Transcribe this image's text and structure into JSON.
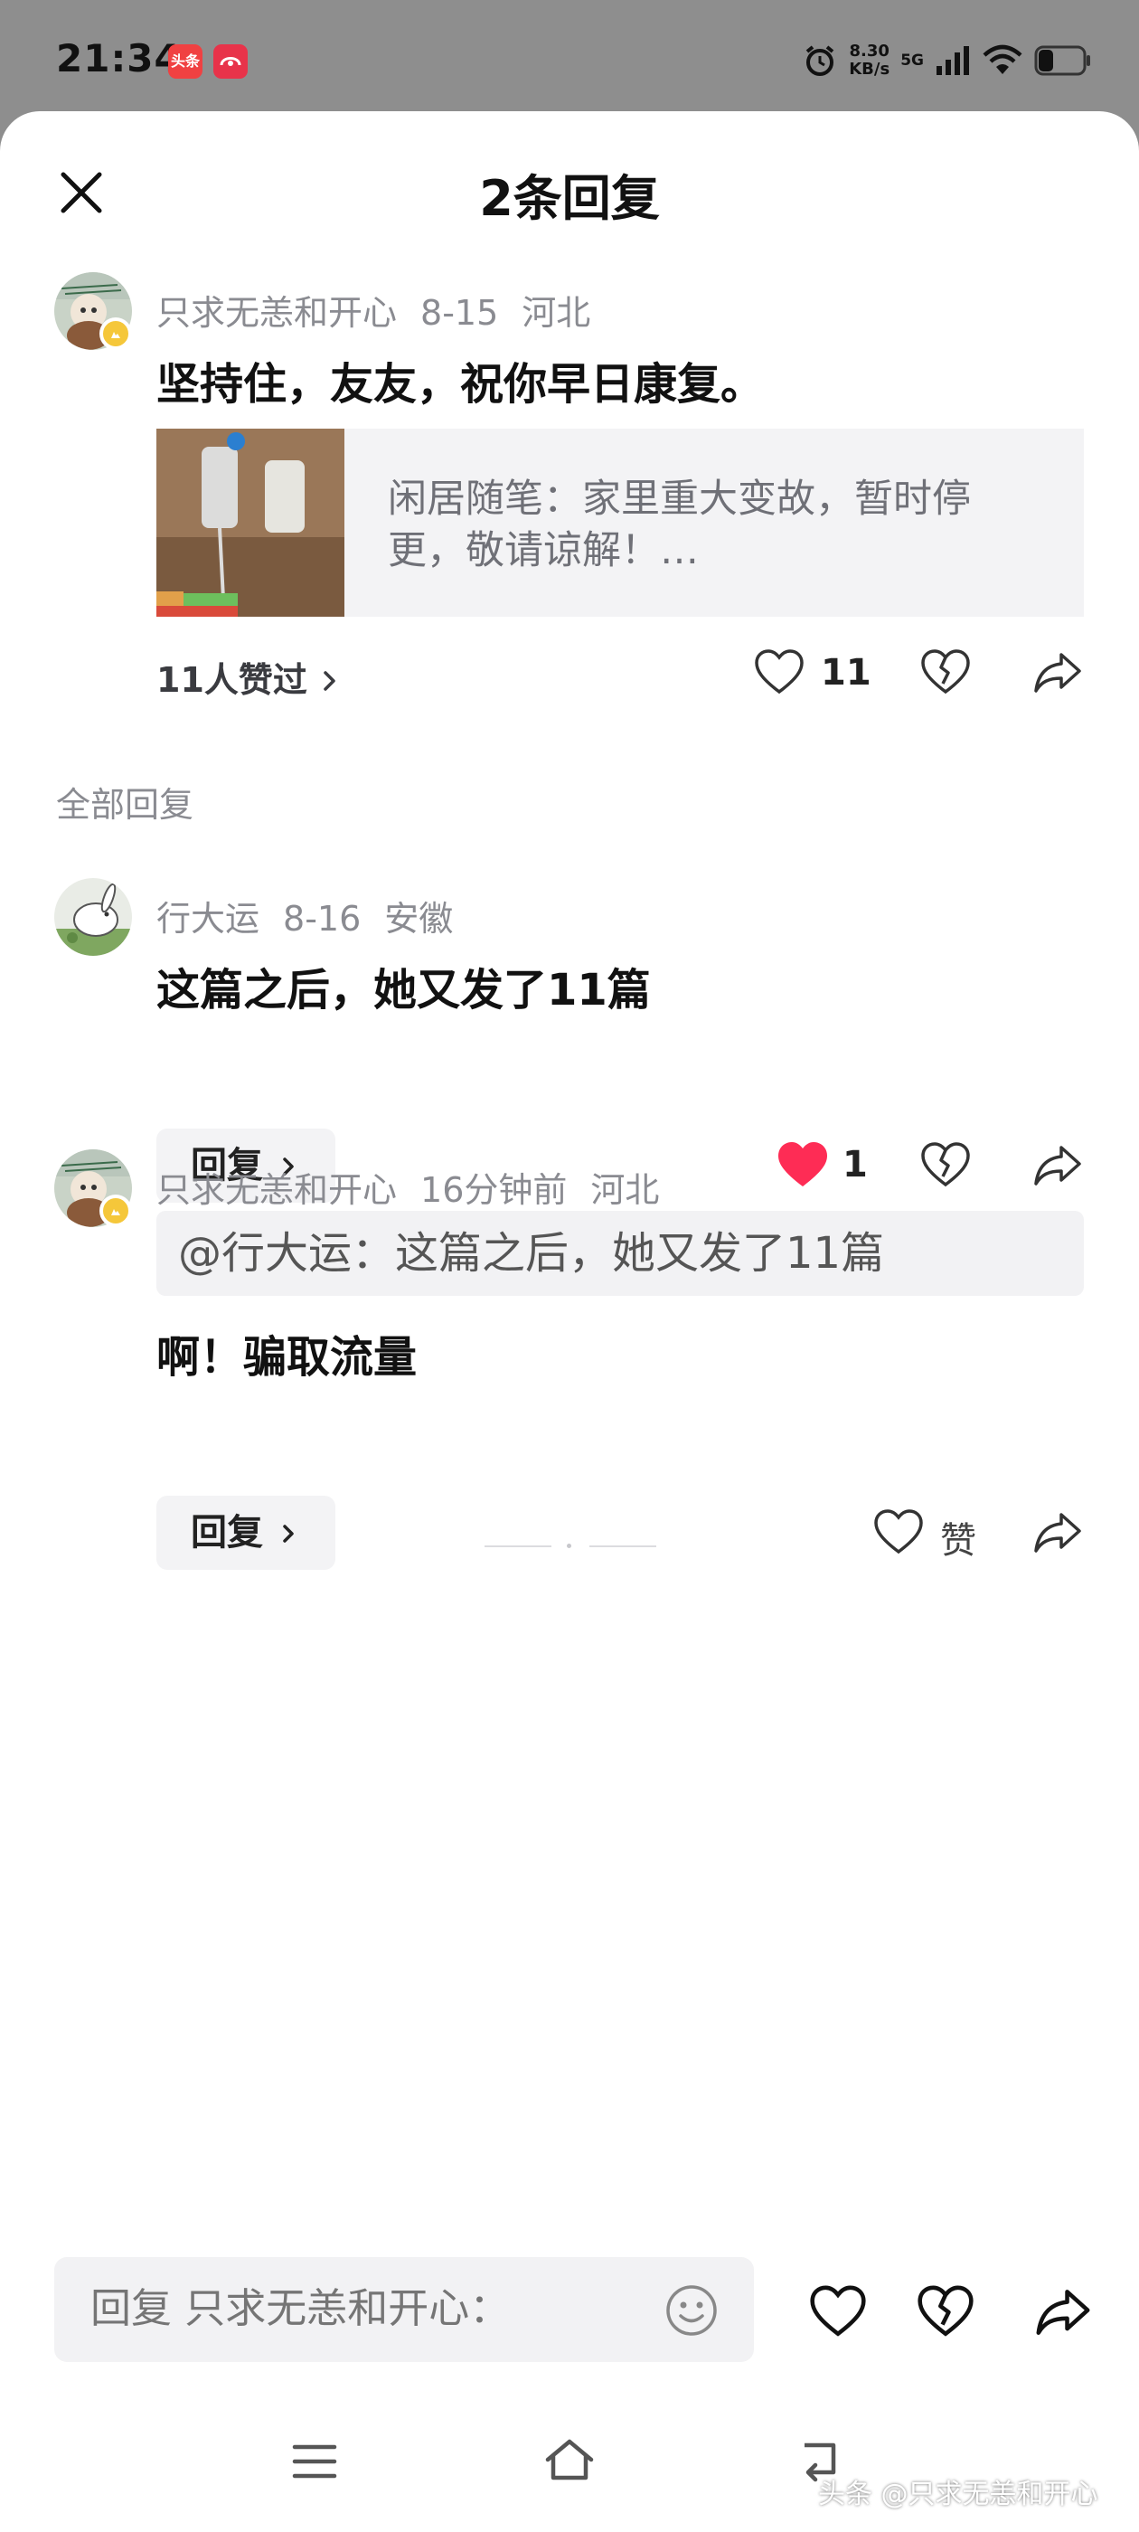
{
  "status_bar": {
    "time": "21:34",
    "app1_label": "头条",
    "net_speed_value": "8.30",
    "net_speed_unit": "KB/s",
    "network": "5G"
  },
  "header": {
    "title": "2条回复",
    "close_icon": "close-icon"
  },
  "main_comment": {
    "author": "只求无恙和开心",
    "date": "8-15",
    "location": "河北",
    "text": "坚持住，友友，祝你早日康复。",
    "article": {
      "text": "闲居随笔：家里重大变故，暂时停更，敬请谅解！…"
    },
    "likers": "11人赞过",
    "like_count": "11"
  },
  "section_label": "全部回复",
  "replies": [
    {
      "author": "行大运",
      "date": "8-16",
      "location": "安徽",
      "text": "这篇之后，她又发了11篇",
      "reply_label": "回复",
      "like_count": "1",
      "liked": true
    },
    {
      "author": "只求无恙和开心",
      "date": "16分钟前",
      "location": "河北",
      "quote": "@行大运：这篇之后，她又发了11篇",
      "text": "啊！骗取流量",
      "reply_label": "回复",
      "like_label": "赞",
      "liked": false
    }
  ],
  "input_bar": {
    "placeholder": "回复 只求无恙和开心："
  },
  "watermark": "头条 @只求无恙和开心",
  "colors": {
    "liked_red": "#fe2c55",
    "text_primary": "#111111",
    "text_secondary": "#8a8b91",
    "card_bg": "#f3f3f5",
    "badge_gold": "#f5c73a"
  }
}
